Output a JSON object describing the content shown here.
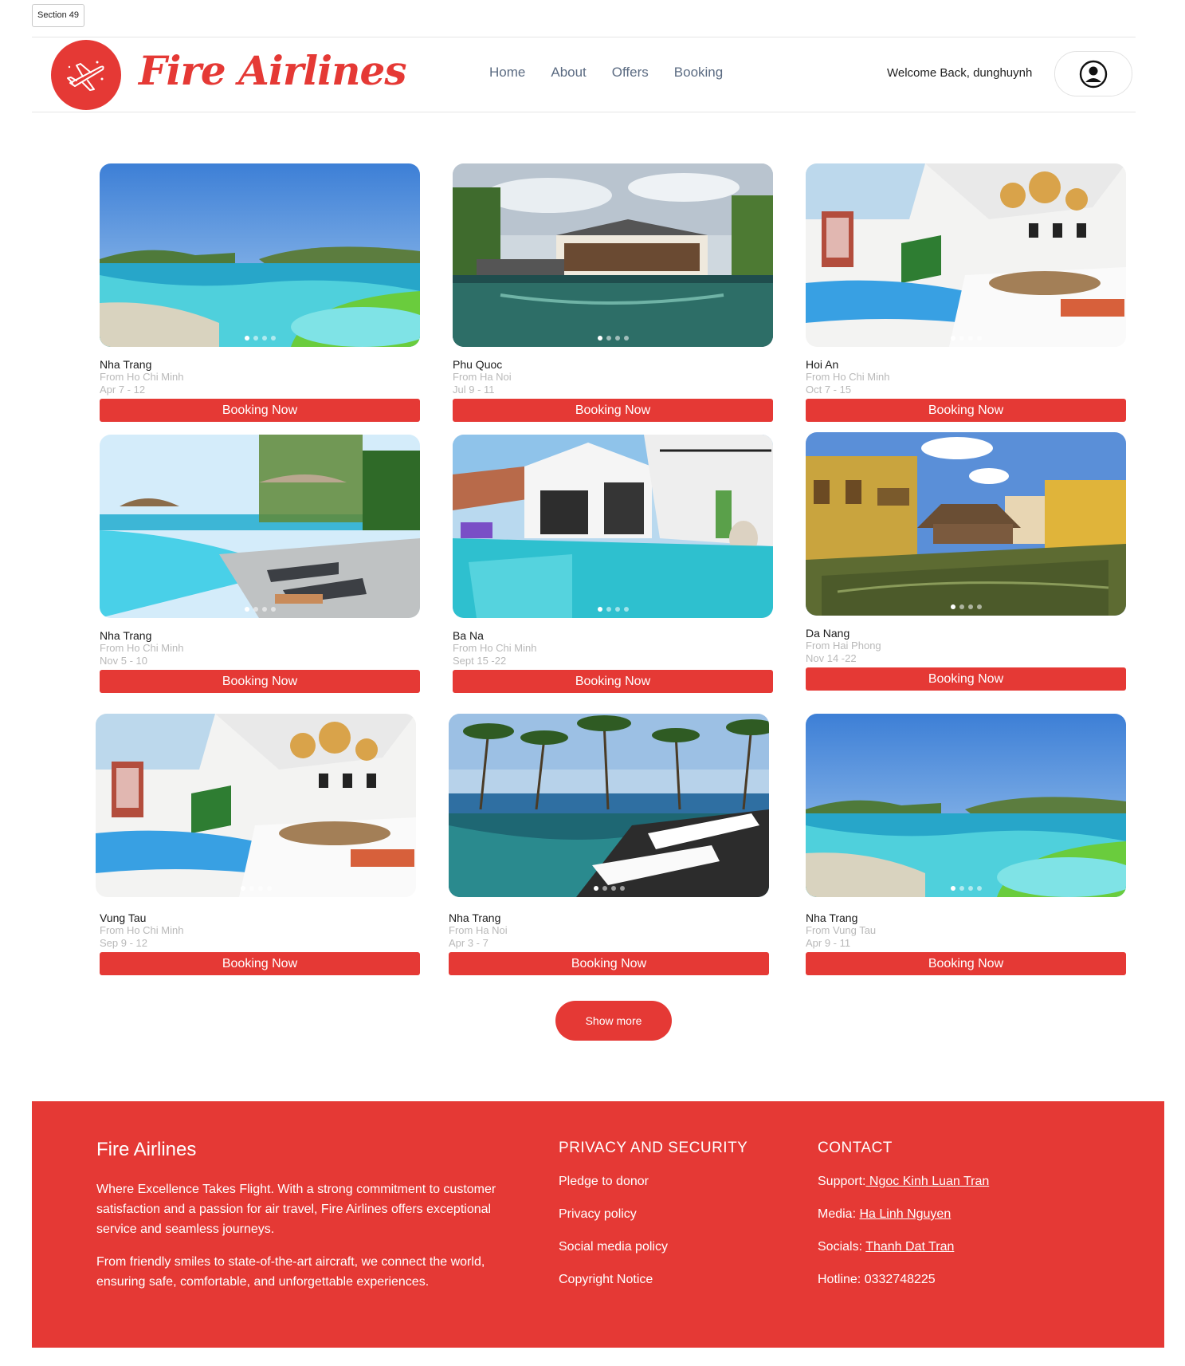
{
  "section_label": "Section 49",
  "brand": {
    "name": "Fire Airlines",
    "accent": "#e53935"
  },
  "nav": [
    "Home",
    "About",
    "Offers",
    "Booking"
  ],
  "user": {
    "welcome": "Welcome Back, dunghuynh",
    "icon": "user-circle-icon"
  },
  "cards": [
    {
      "dest": "Nha Trang",
      "from": "From Ho Chi Minh",
      "dates": "Apr 7 - 12",
      "button": "Booking Now",
      "scene": "lagoon"
    },
    {
      "dest": "Phu Quoc",
      "from": "From Ha Noi",
      "dates": "Jul 9 - 11",
      "button": "Booking Now",
      "scene": "villa"
    },
    {
      "dest": "Hoi An",
      "from": "From Ho Chi Minh",
      "dates": "Oct 7 - 15",
      "button": "Booking Now",
      "scene": "interior"
    },
    {
      "dest": "Nha Trang",
      "from": "From Ho Chi Minh",
      "dates": "Nov 5 - 10",
      "button": "Booking Now",
      "scene": "beachpool"
    },
    {
      "dest": "Ba Na",
      "from": "From Ho Chi Minh",
      "dates": "Sept 15 -22",
      "button": "Booking Now",
      "scene": "whitevilla"
    },
    {
      "dest": "Da Nang",
      "from": "From Hai Phong",
      "dates": "Nov 14 -22",
      "button": "Booking Now",
      "scene": "oldtown"
    },
    {
      "dest": "Vung Tau",
      "from": "From Ho Chi Minh",
      "dates": "Sep 9 - 12",
      "button": "Booking Now",
      "scene": "interior"
    },
    {
      "dest": "Nha Trang",
      "from": "From Ha Noi",
      "dates": "Apr 3 - 7",
      "button": "Booking Now",
      "scene": "palms"
    },
    {
      "dest": "Nha Trang",
      "from": "From Vung Tau",
      "dates": "Apr 9 - 11",
      "button": "Booking Now",
      "scene": "lagoon"
    }
  ],
  "show_more": "Show more",
  "footer": {
    "title": "Fire Airlines",
    "about": [
      "Where Excellence Takes Flight. With a strong commitment to customer satisfaction and a passion for air travel, Fire Airlines offers exceptional service and seamless journeys.",
      "From friendly smiles to state-of-the-art aircraft, we connect the world, ensuring safe, comfortable, and unforgettable experiences."
    ],
    "privacy_heading": "PRIVACY AND SECURITY",
    "privacy_links": [
      "Pledge to donor",
      "Privacy policy",
      "Social media policy",
      "Copyright Notice"
    ],
    "contact_heading": "CONTACT",
    "contacts": [
      {
        "label": "Support:",
        "value": " Ngoc Kinh Luan Tran"
      },
      {
        "label": "Media: ",
        "value": "Ha Linh Nguyen"
      },
      {
        "label": "Socials: ",
        "value": "Thanh Dat Tran"
      },
      {
        "label": "Hotline: 0332748225",
        "value": ""
      }
    ]
  }
}
